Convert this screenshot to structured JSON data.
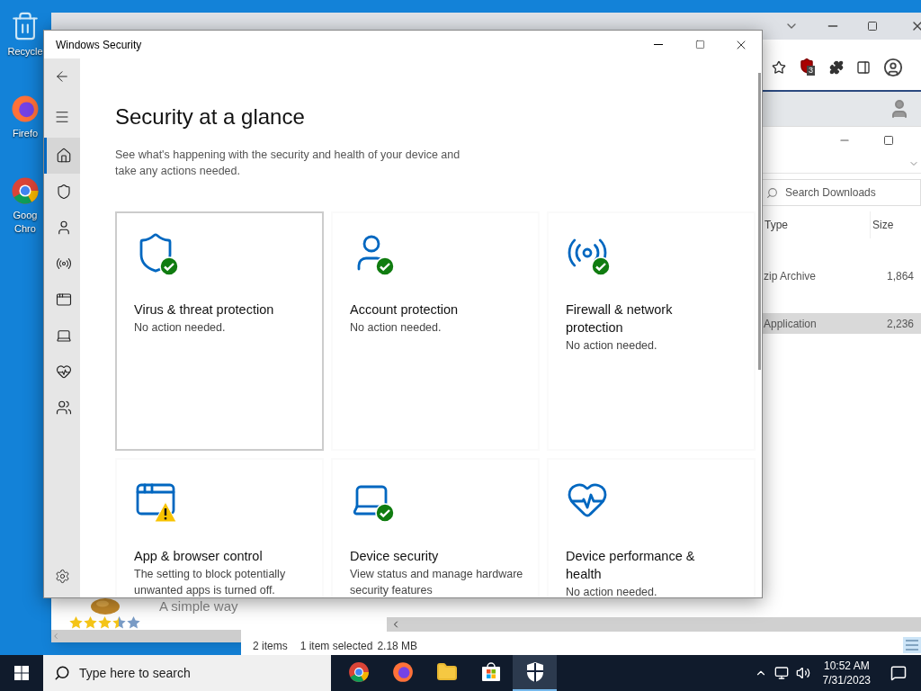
{
  "desktop_icons": [
    {
      "kind": "recycle",
      "lines": [
        "Recycle"
      ]
    },
    {
      "kind": "firefox",
      "lines": [
        "Firefo"
      ]
    },
    {
      "kind": "chrome",
      "lines": [
        "Goog",
        "Chro"
      ]
    }
  ],
  "browser": {
    "extension_badge": "3",
    "page_text": "A simple way",
    "stars": 3.5
  },
  "explorer": {
    "search": {
      "placeholder": "Search Downloads"
    },
    "columns": [
      "Type",
      "Size"
    ],
    "rows": [
      {
        "type": "zip Archive",
        "size": "1,864",
        "selected": false
      },
      {
        "type": "Application",
        "size": "2,236",
        "selected": true
      }
    ],
    "status": [
      "2 items",
      "1 item selected",
      "2.18 MB"
    ]
  },
  "security": {
    "title": "Windows Security",
    "nav": [
      {
        "kind": "home",
        "selected": true
      },
      {
        "kind": "shield",
        "selected": false
      },
      {
        "kind": "person",
        "selected": false
      },
      {
        "kind": "wireless",
        "selected": false
      },
      {
        "kind": "window",
        "selected": false
      },
      {
        "kind": "laptop",
        "selected": false
      },
      {
        "kind": "heart",
        "selected": false
      },
      {
        "kind": "family",
        "selected": false
      }
    ],
    "heading": "Security at a glance",
    "description": "See what's happening with the security and health of your device and take any actions needed.",
    "cards": [
      {
        "kind": "shield",
        "check": true,
        "warning": false,
        "title": "Virus & threat protection",
        "status": "No action needed.",
        "focused": true
      },
      {
        "kind": "person",
        "check": true,
        "warning": false,
        "title": "Account protection",
        "status": "No action needed.",
        "focused": false
      },
      {
        "kind": "wireless",
        "check": true,
        "warning": false,
        "title": "Firewall & network protection",
        "status": "No action needed.",
        "focused": false
      },
      {
        "kind": "window",
        "check": false,
        "warning": true,
        "title": "App & browser control",
        "status": "The setting to block potentially unwanted apps is turned off.",
        "focused": false
      },
      {
        "kind": "laptop",
        "check": true,
        "warning": false,
        "title": "Device security",
        "status": "View status and manage hardware security features",
        "focused": false
      },
      {
        "kind": "heart",
        "check": false,
        "warning": false,
        "title": "Device performance & health",
        "status": "No action needed.",
        "focused": false
      }
    ]
  },
  "taskbar": {
    "search_placeholder": "Type here to search",
    "apps": [
      {
        "kind": "chrome",
        "active": false
      },
      {
        "kind": "firefox",
        "active": false
      },
      {
        "kind": "folder",
        "active": false
      },
      {
        "kind": "store",
        "active": false
      },
      {
        "kind": "security",
        "active": true
      }
    ],
    "time": "10:52 AM",
    "date": "7/31/2023"
  }
}
